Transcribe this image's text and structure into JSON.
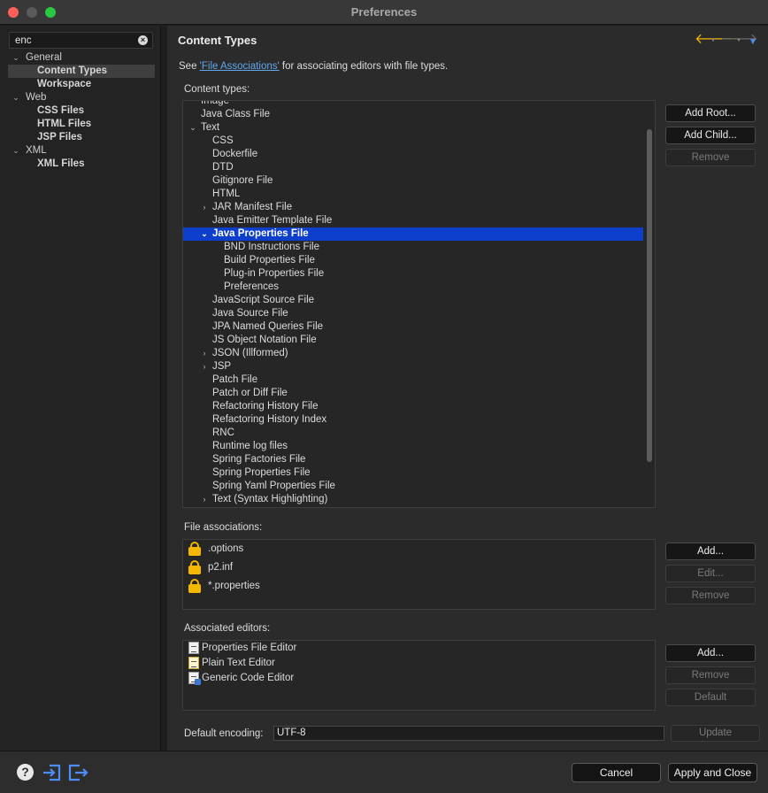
{
  "window": {
    "title": "Preferences"
  },
  "sidebar": {
    "filter": {
      "value": "enc"
    },
    "tree": [
      {
        "label": "General",
        "type": "group",
        "expanded": true
      },
      {
        "label": "Content Types",
        "type": "child",
        "selected": true
      },
      {
        "label": "Workspace",
        "type": "child"
      },
      {
        "label": "Web",
        "type": "group",
        "expanded": true
      },
      {
        "label": "CSS Files",
        "type": "child"
      },
      {
        "label": "HTML Files",
        "type": "child"
      },
      {
        "label": "JSP Files",
        "type": "child"
      },
      {
        "label": "XML",
        "type": "group",
        "expanded": true
      },
      {
        "label": "XML Files",
        "type": "child"
      }
    ]
  },
  "page": {
    "title": "Content Types",
    "see_prefix": "See ",
    "see_link": "'File Associations'",
    "see_suffix": " for associating editors with file types."
  },
  "content_types": {
    "label": "Content types:",
    "items": [
      {
        "label": "Image",
        "level": 0,
        "toggle": ""
      },
      {
        "label": "Java Class File",
        "level": 0,
        "toggle": ""
      },
      {
        "label": "Text",
        "level": 0,
        "toggle": "expanded"
      },
      {
        "label": "CSS",
        "level": 1,
        "toggle": ""
      },
      {
        "label": "Dockerfile",
        "level": 1,
        "toggle": ""
      },
      {
        "label": "DTD",
        "level": 1,
        "toggle": ""
      },
      {
        "label": "Gitignore File",
        "level": 1,
        "toggle": ""
      },
      {
        "label": "HTML",
        "level": 1,
        "toggle": ""
      },
      {
        "label": "JAR Manifest File",
        "level": 1,
        "toggle": "collapsed"
      },
      {
        "label": "Java Emitter Template File",
        "level": 1,
        "toggle": ""
      },
      {
        "label": "Java Properties File",
        "level": 1,
        "toggle": "expanded",
        "selected": true
      },
      {
        "label": "BND Instructions File",
        "level": 2,
        "toggle": ""
      },
      {
        "label": "Build Properties File",
        "level": 2,
        "toggle": ""
      },
      {
        "label": "Plug-in Properties File",
        "level": 2,
        "toggle": ""
      },
      {
        "label": "Preferences",
        "level": 2,
        "toggle": ""
      },
      {
        "label": "JavaScript Source File",
        "level": 1,
        "toggle": ""
      },
      {
        "label": "Java Source File",
        "level": 1,
        "toggle": ""
      },
      {
        "label": "JPA Named Queries File",
        "level": 1,
        "toggle": ""
      },
      {
        "label": "JS Object Notation File",
        "level": 1,
        "toggle": ""
      },
      {
        "label": "JSON (Illformed)",
        "level": 1,
        "toggle": "collapsed"
      },
      {
        "label": "JSP",
        "level": 1,
        "toggle": "collapsed"
      },
      {
        "label": "Patch File",
        "level": 1,
        "toggle": ""
      },
      {
        "label": "Patch or Diff File",
        "level": 1,
        "toggle": ""
      },
      {
        "label": "Refactoring History File",
        "level": 1,
        "toggle": ""
      },
      {
        "label": "Refactoring History Index",
        "level": 1,
        "toggle": ""
      },
      {
        "label": "RNC",
        "level": 1,
        "toggle": ""
      },
      {
        "label": "Runtime log files",
        "level": 1,
        "toggle": ""
      },
      {
        "label": "Spring Factories File",
        "level": 1,
        "toggle": ""
      },
      {
        "label": "Spring Properties File",
        "level": 1,
        "toggle": ""
      },
      {
        "label": "Spring Yaml Properties File",
        "level": 1,
        "toggle": ""
      },
      {
        "label": "Text (Syntax Highlighting)",
        "level": 1,
        "toggle": "collapsed"
      }
    ],
    "buttons": {
      "add_root": "Add Root...",
      "add_child": "Add Child...",
      "remove": "Remove"
    }
  },
  "file_associations": {
    "label": "File associations:",
    "items": [
      ".options",
      "p2.inf",
      "*.properties"
    ],
    "buttons": {
      "add": "Add...",
      "edit": "Edit...",
      "remove": "Remove"
    }
  },
  "associated_editors": {
    "label": "Associated editors:",
    "items": [
      {
        "label": "Properties File Editor",
        "icon": "properties-file-icon"
      },
      {
        "label": "Plain Text Editor",
        "icon": "text-file-icon"
      },
      {
        "label": "Generic Code Editor",
        "icon": "code-file-icon"
      }
    ],
    "buttons": {
      "add": "Add...",
      "remove": "Remove",
      "default": "Default"
    }
  },
  "encoding": {
    "label": "Default encoding:",
    "value": "UTF-8",
    "update": "Update"
  },
  "footer": {
    "cancel": "Cancel",
    "apply_close": "Apply and Close"
  },
  "colors": {
    "accent": "#0d3fcc",
    "link": "#60a7ef",
    "lock": "#f5b800",
    "back_arrow": "#f4b400"
  }
}
